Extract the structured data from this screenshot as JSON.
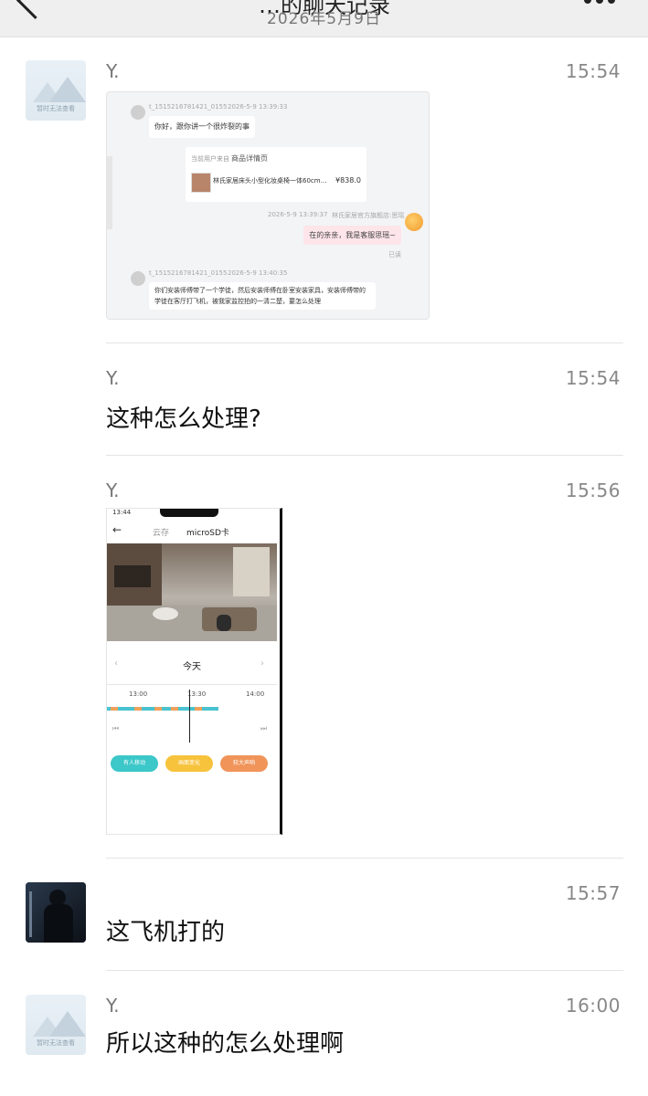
{
  "header": {
    "title": "…的聊天记录",
    "date": "2026年5月9日",
    "back_icon": "chevron-left-icon",
    "more_icon": "more-dots-icon"
  },
  "avatar_placeholder_text": "暂时无法查看",
  "messages": [
    {
      "sender": "Y.",
      "time": "15:54",
      "type": "image"
    },
    {
      "sender": "Y.",
      "time": "15:54",
      "type": "text",
      "text": "这种怎么处理?"
    },
    {
      "sender": "Y.",
      "time": "15:56",
      "type": "image"
    },
    {
      "sender": "",
      "time": "15:57",
      "type": "text",
      "text": "这飞机打的"
    },
    {
      "sender": "Y.",
      "time": "16:00",
      "type": "text",
      "text": "所以这种的怎么处理啊"
    }
  ],
  "shot_chat": {
    "user_id_1": "t_1515216781421_0155",
    "time_1": "2026-5-9 13:39:33",
    "msg_1": "你好，跟你讲一个很炸裂的事",
    "card_source": "当前用户来自",
    "card_title": "商品详情页",
    "card_product": "林氏家居床头小型化妆桌椅一体60cm…",
    "card_price": "¥838.0",
    "shop_time": "2026-5-9 13:39:37",
    "shop_name": "林氏家居官方旗舰店:思瑶",
    "shop_msg": "在的亲亲，我是客服思瑶~",
    "read_status": "已读",
    "user_id_2": "t_1515216781421_0155",
    "time_2": "2026-5-9 13:40:35",
    "msg_2": "你们安装师傅带了一个学徒，然后安装师傅在卧室安装家具，安装师傅带的学徒在客厅打飞机，被我家监控拍的一清二楚，要怎么处理"
  },
  "shot_phone": {
    "status_time": "13:44",
    "tab_cloud": "云存",
    "tab_sd": "microSD卡",
    "day_label": "今天",
    "ticks": [
      "13:00",
      "13:30",
      "14:00"
    ],
    "btn_1": "有人移动",
    "btn_2": "画面变化",
    "btn_3": "较大声响",
    "btn_colors": [
      "#3cc7c9",
      "#f7c23c",
      "#f0945a"
    ]
  }
}
